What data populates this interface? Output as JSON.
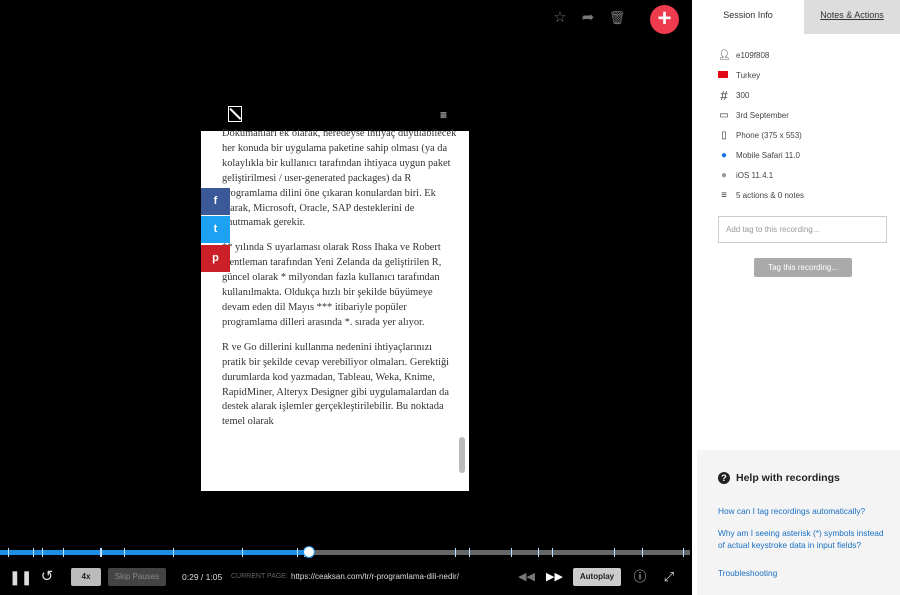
{
  "player": {
    "top_icons": [
      "star-icon",
      "share-icon",
      "trash-icon"
    ],
    "add_label": "+"
  },
  "site": {
    "menu_icon": "≡",
    "share_buttons": [
      {
        "name": "facebook",
        "glyph": "f",
        "color": "#3b5998"
      },
      {
        "name": "twitter",
        "glyph": "t",
        "color": "#1da1f2"
      },
      {
        "name": "pinterest",
        "glyph": "p",
        "color": "#cb2027"
      }
    ],
    "p1": "Dokümanları ek olarak, neredeyse ihtiyaç duyulabilecek her konuda bir uygulama paketine sahip olması (ya da kolaylıkla bir kullanıcı tarafından ihtiyaca uygun paket geliştirilmesi / user-generated packages) da R programlama dilini öne çıkaran konulardan biri. Ek olarak, Microsoft, Oracle, SAP desteklerini de unutmamak gerekir.",
    "p2": "** yılında S uyarlaması olarak Ross Ihaka ve Robert Gentleman tarafından Yeni Zelanda da geliştirilen R, güncel olarak * milyondan fazla kullanıcı tarafından kullanılmakta. Oldukça hızlı bir şekilde büyümeye devam eden dil Mayıs *** itibariyle popüler programlama dilleri arasında *. sırada yer alıyor.",
    "p3": "R ve Go dillerini kullanma nedenini ihtiyaçlarınızı pratik bir şekilde cevap verebiliyor olmaları. Gerektiği durumlarda kod yazmadan, Tableau, Weka, Knime, RapidMiner, Alteryx Designer gibi uygulamalardan da destek alarak işlemler gerçekleştirilebilir. Bu noktada temel olarak"
  },
  "timeline": {
    "progress_fraction": 0.446,
    "event_markers": [
      0.012,
      0.048,
      0.061,
      0.092,
      0.145,
      0.146,
      0.18,
      0.25,
      0.35,
      0.43,
      0.44,
      0.66,
      0.68,
      0.74,
      0.78,
      0.8,
      0.89,
      0.93,
      0.99
    ],
    "colors": {
      "played": "#1e8fe6",
      "unplayed": "#666666"
    }
  },
  "controls": {
    "speed": "4x",
    "skip_pauses": "Skip Pauses",
    "time": "0:29 / 1:05",
    "current_page_label": "CURRENT PAGE:",
    "current_page_url": "https://ceaksan.com/tr/r-programlama-dili-nedir/",
    "autoplay": "Autoplay"
  },
  "tabs": {
    "session_info": "Session Info",
    "notes_actions": "Notes & Actions"
  },
  "session": {
    "user_id": "e109f808",
    "country": "Turkey",
    "number": "300",
    "date": "3rd September",
    "device": "Phone (375 x 553)",
    "browser": "Mobile Safari 11.0",
    "os": "iOS 11.4.1",
    "actions": "5 actions & 0 notes"
  },
  "tag": {
    "placeholder": "Add tag to this recording...",
    "button": "Tag this recording..."
  },
  "help": {
    "title": "Help with recordings",
    "links": [
      "How can I tag recordings automatically?",
      "Why am I seeing asterisk (*) symbols instead of actual keystroke data in input fields?",
      "Troubleshooting"
    ]
  }
}
